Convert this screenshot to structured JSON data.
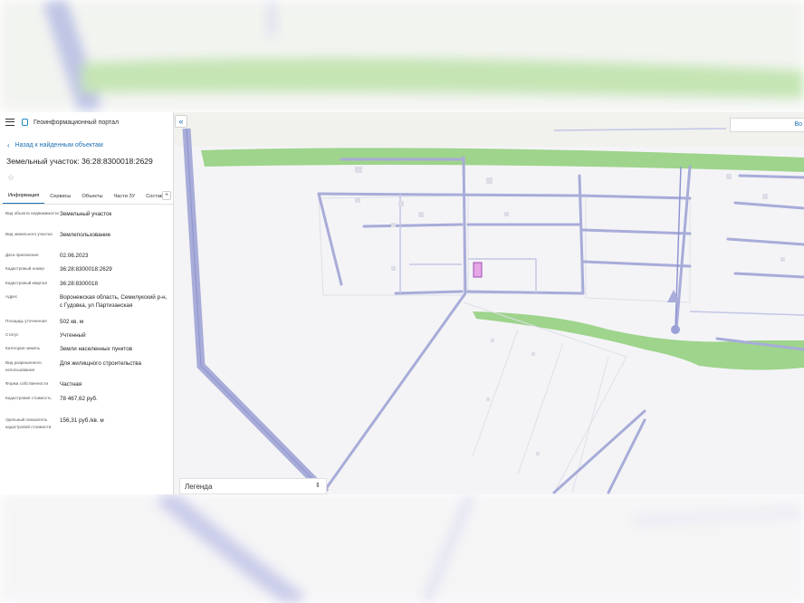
{
  "header": {
    "portal_title": "Геоинформационный портал",
    "back_label": "Назад к найденным объектам"
  },
  "parcel": {
    "title": "Земельный участок: 36:28:8300018:2629"
  },
  "tabs": [
    {
      "label": "Информация",
      "active": true
    },
    {
      "label": "Сервисы",
      "active": false
    },
    {
      "label": "Объекты",
      "active": false
    },
    {
      "label": "Части ЗУ",
      "active": false
    },
    {
      "label": "Состав",
      "active": false
    }
  ],
  "tab_add_label": "+",
  "attributes": [
    {
      "label": "Вид объекта недвижимости",
      "value": "Земельный участок"
    },
    {
      "label": "Вид земельного участка",
      "value": "Землепользование"
    },
    {
      "label": "Дата присвоения",
      "value": "02.06.2023"
    },
    {
      "label": "Кадастровый номер",
      "value": "36:28:8300018:2629"
    },
    {
      "label": "Кадастровый квартал",
      "value": "36:28:8300018"
    },
    {
      "label": "Адрес",
      "value": "Воронежская область, Семилукский р-н, с Гудовка, ул Партизанская"
    },
    {
      "label": "Площадь уточненная",
      "value": "502 кв. м"
    },
    {
      "label": "Статус",
      "value": "Учтенный"
    },
    {
      "label": "Категория земель",
      "value": "Земли населенных пунктов"
    },
    {
      "label": "Вид разрешенного использования",
      "value": "Для жилищного строительства"
    },
    {
      "label": "Форма собственности",
      "value": "Частная"
    },
    {
      "label": "Кадастровая стоимость",
      "value": "78 467,62 руб."
    },
    {
      "label": "Удельный показатель кадастровой стоимости",
      "value": "156,31 руб./кв. м"
    }
  ],
  "map": {
    "legend_label": "Легенда",
    "search_label": "Во",
    "collapse_glyph": "«",
    "colors": {
      "background": "#f4f4f7",
      "green": "#9ed48b",
      "road": "#a8acd8",
      "highlight": "#e6a6e6"
    }
  }
}
